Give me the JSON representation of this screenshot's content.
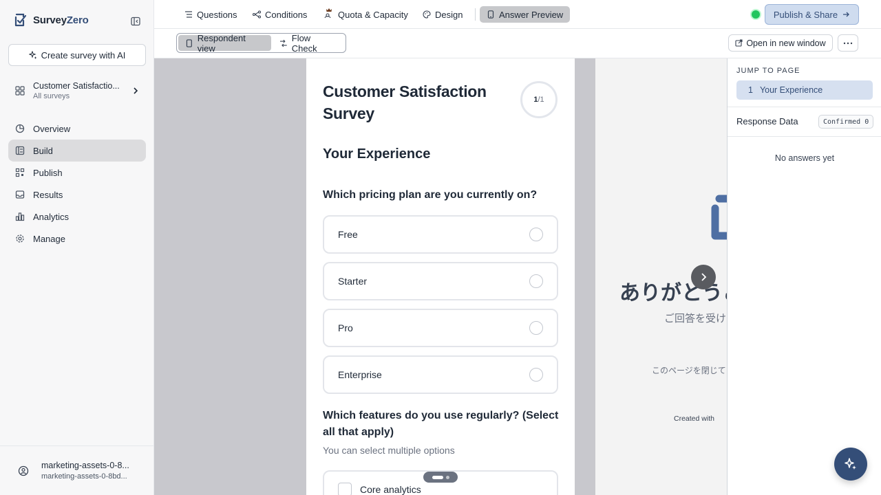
{
  "brand": {
    "name_a": "Survey",
    "name_b": "Zero"
  },
  "sidebar": {
    "create_label": "Create survey with AI",
    "survey": {
      "title": "Customer Satisfactio...",
      "subtitle": "All surveys"
    },
    "nav": [
      {
        "label": "Overview",
        "icon": "pie-chart-icon"
      },
      {
        "label": "Build",
        "icon": "build-icon",
        "active": true
      },
      {
        "label": "Publish",
        "icon": "qr-icon"
      },
      {
        "label": "Results",
        "icon": "inbox-icon"
      },
      {
        "label": "Analytics",
        "icon": "bar-chart-icon"
      },
      {
        "label": "Manage",
        "icon": "gear-icon"
      }
    ],
    "user": {
      "name": "marketing-assets-0-8...",
      "email": "marketing-assets-0-8bd..."
    }
  },
  "topbar": {
    "tabs": [
      {
        "label": "Questions",
        "icon": "list-icon"
      },
      {
        "label": "Conditions",
        "icon": "branch-icon"
      },
      {
        "label": "Quota & Capacity",
        "icon": "quota-crown-icon"
      },
      {
        "label": "Design",
        "icon": "palette-icon"
      },
      {
        "label": "Answer Preview",
        "icon": "phone-icon",
        "active": true
      }
    ],
    "publish_label": "Publish & Share",
    "status_color": "#22c55e"
  },
  "subbar": {
    "views": [
      {
        "label": "Respondent view",
        "icon": "phone-icon",
        "active": true
      },
      {
        "label": "Flow Check",
        "icon": "flow-icon"
      }
    ],
    "open_label": "Open in new window"
  },
  "preview": {
    "survey_title": "Customer Satisfaction Survey",
    "progress": {
      "current": "1",
      "total": "/1"
    },
    "page_title": "Your Experience",
    "q1": {
      "text": "Which pricing plan are you currently on?",
      "options": [
        "Free",
        "Starter",
        "Pro",
        "Enterprise"
      ]
    },
    "q2": {
      "text": "Which features do you use regularly? (Select all that apply)",
      "hint": "You can select multiple options",
      "options": [
        "Core analytics"
      ]
    },
    "thanks": {
      "title": "ありがとうご",
      "subtitle": "ご回答を受け",
      "close_note": "このページを閉じて",
      "created_with": "Created with"
    }
  },
  "right_panel": {
    "jump_label": "JUMP TO PAGE",
    "pages": [
      {
        "num": "1",
        "label": "Your Experience"
      }
    ],
    "response_title": "Response Data",
    "confirmed_badge": "Confirmed 0",
    "empty_text": "No answers yet"
  },
  "colors": {
    "brand": "#344e78",
    "accent_light": "#cfdcef"
  }
}
